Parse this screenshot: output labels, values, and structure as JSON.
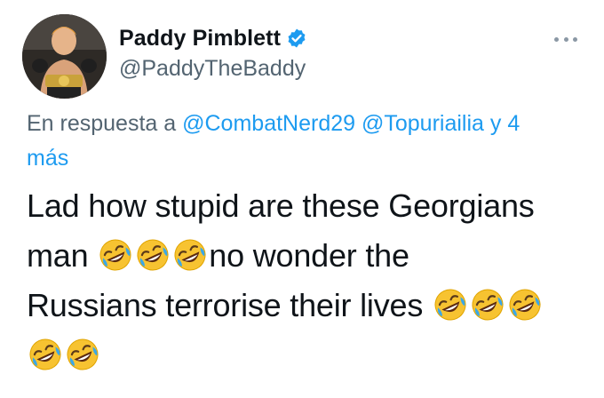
{
  "tweet": {
    "author": {
      "display_name": "Paddy Pimblett",
      "handle": "@PaddyTheBaddy",
      "verified": true,
      "avatar_icon": "fighter-photo-avatar"
    },
    "more_icon": "more-horizontal-icon",
    "reply": {
      "prefix": "En respuesta a",
      "mentions": [
        "@CombatNerd29",
        "@Topuriailia"
      ],
      "suffix_line1": "y 4",
      "suffix_line2": "más"
    },
    "text": {
      "line1": "Lad how stupid are these Georgians",
      "line2_a": "man",
      "line2_b": "no wonder the",
      "line3": "Russians terrorise their lives",
      "emoji_name": "rolling-on-the-floor-laughing-emoji"
    },
    "colors": {
      "link": "#1d9bf0",
      "secondary_text": "#536471",
      "verified_badge": "#1d9bf0",
      "emoji_face": "#f7c331"
    }
  }
}
